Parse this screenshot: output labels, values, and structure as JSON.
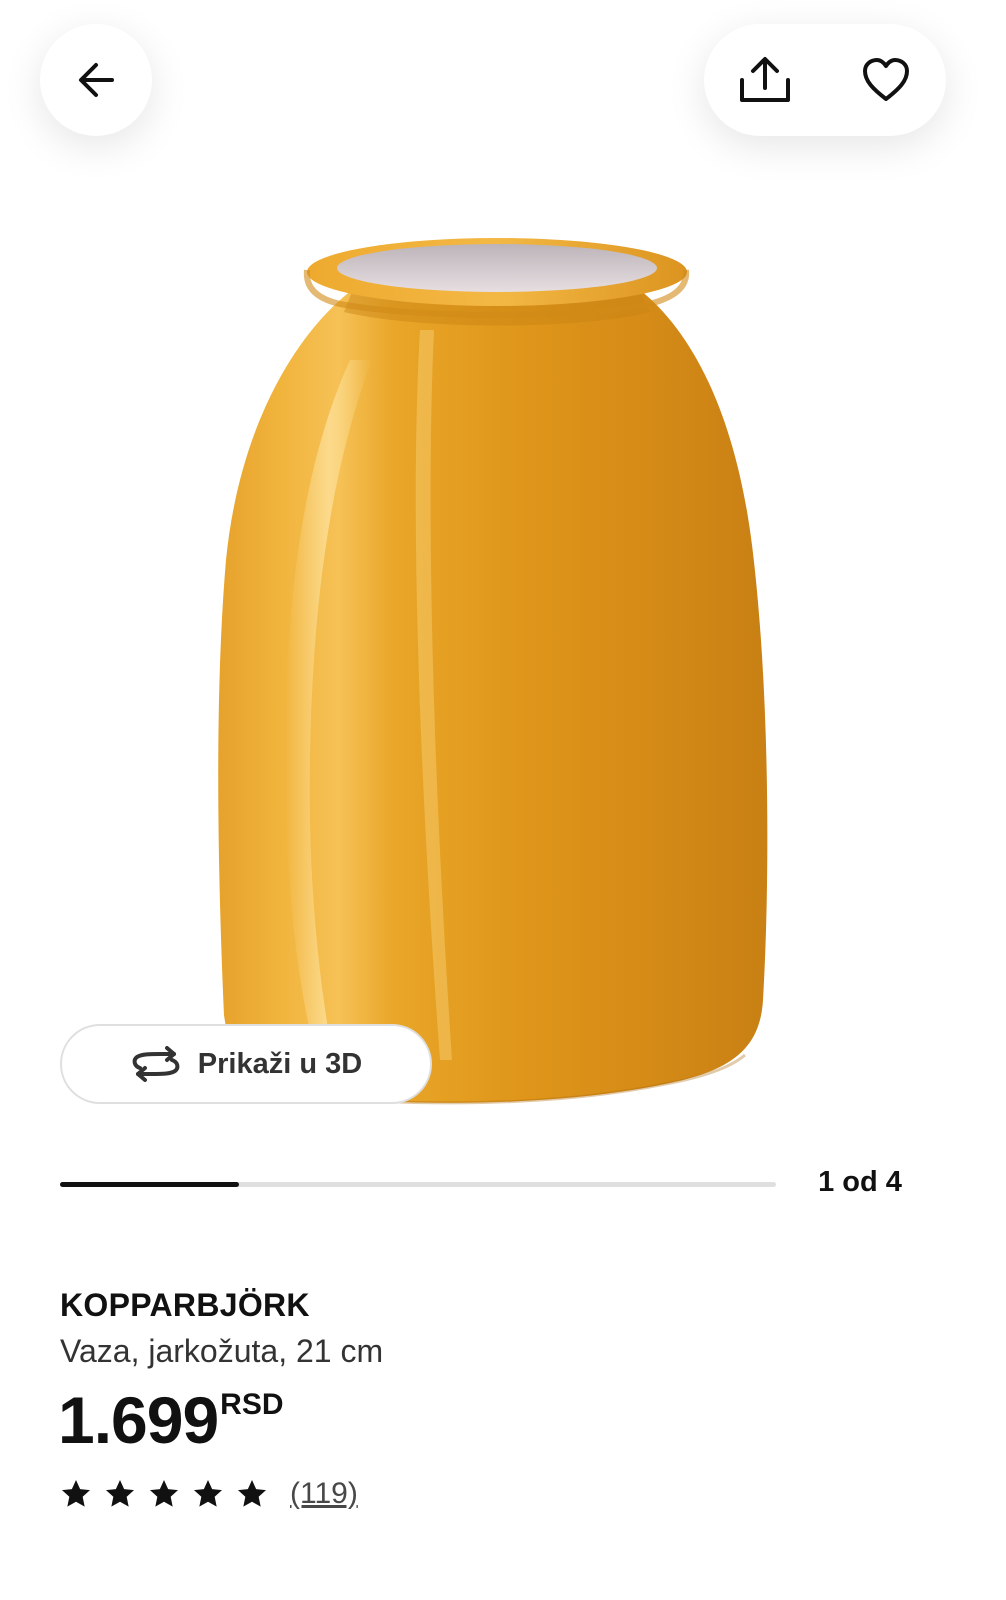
{
  "product": {
    "name": "KOPPARBJÖRK",
    "description": "Vaza, jarkožuta, 21 cm",
    "price_amount": "1.699",
    "price_currency": "RSD",
    "rating": 5,
    "review_count": "(119)",
    "color": "#e29a1c"
  },
  "gallery": {
    "view_3d_label": "Prikaži u 3D",
    "counter": "1 od 4",
    "current": 1,
    "total": 4,
    "progress_fraction": 0.25
  },
  "icons": {
    "back": "arrow-left-icon",
    "share": "share-icon",
    "favorite": "heart-icon",
    "rotate": "rotate-3d-icon",
    "star": "star-icon"
  }
}
